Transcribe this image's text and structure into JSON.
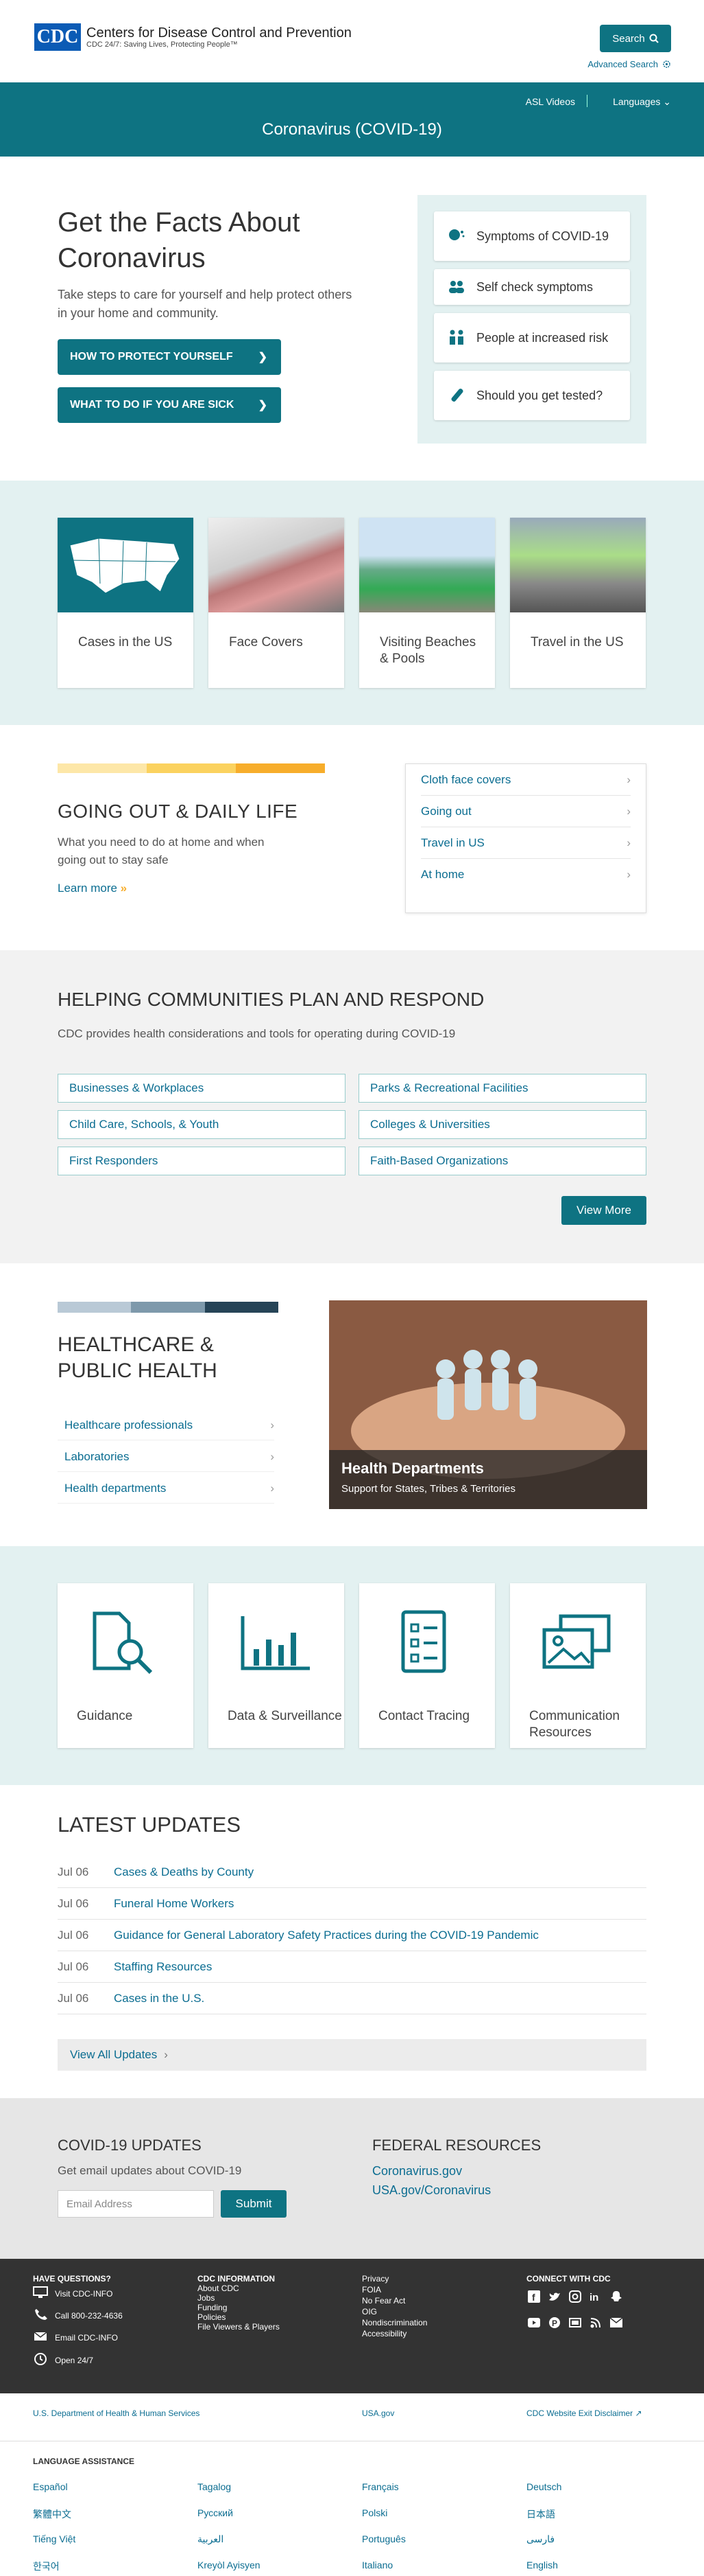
{
  "header": {
    "logo_text": "CDC",
    "org_name": "Centers for Disease Control and Prevention",
    "tagline": "CDC 24/7: Saving Lives, Protecting People™",
    "search_label": "Search",
    "advanced_search": "Advanced Search"
  },
  "banner": {
    "title": "Coronavirus (COVID-19)",
    "asl": "ASL Videos",
    "languages": "Languages"
  },
  "hero": {
    "title": "Get the Facts About Coronavirus",
    "lead": "Take steps to care for yourself and help protect others in your home and community.",
    "btn_protect": "HOW TO PROTECT YOURSELF",
    "btn_sick": "WHAT TO DO IF YOU ARE SICK",
    "links": [
      {
        "label": "Symptoms of COVID-19",
        "icon": "cough-icon"
      },
      {
        "label": "Self check symptoms",
        "icon": "people-icon"
      },
      {
        "label": "People at increased risk",
        "icon": "risk-icon"
      },
      {
        "label": "Should you get tested?",
        "icon": "test-icon"
      }
    ]
  },
  "tiles": [
    {
      "label": "Cases in the US"
    },
    {
      "label": "Face Covers"
    },
    {
      "label": "Visiting Beaches & Pools"
    },
    {
      "label": "Travel in the US"
    }
  ],
  "going_out": {
    "title": "GOING OUT & DAILY LIFE",
    "text": "What you need to do at home and when going out to stay safe",
    "more": "Learn more",
    "links": [
      "Cloth face covers",
      "Going out",
      "Travel in US",
      "At home"
    ],
    "bar_colors": [
      "#fde7a8",
      "#fbd25f",
      "#f7ad2b"
    ]
  },
  "communities": {
    "title": "HELPING COMMUNITIES PLAN AND RESPOND",
    "text": "CDC provides health considerations and tools for operating during COVID-19",
    "links": [
      "Businesses & Workplaces",
      "Parks & Recreational Facilities",
      "Child Care, Schools, & Youth",
      "Colleges & Universities",
      "First Responders",
      "Faith-Based Organizations"
    ],
    "view_more": "View More"
  },
  "healthcare": {
    "title": "HEALTHCARE & PUBLIC HEALTH",
    "links": [
      "Healthcare professionals",
      "Laboratories",
      "Health departments"
    ],
    "photo_title": "Health Departments",
    "photo_sub": "Support for States, Tribes & Territories",
    "bar_colors": [
      "#b9c9d6",
      "#7e99ab",
      "#264457"
    ]
  },
  "tools": [
    {
      "label": "Guidance"
    },
    {
      "label": "Data & Surveillance"
    },
    {
      "label": "Contact Tracing"
    },
    {
      "label": "Communication Resources"
    }
  ],
  "updates": {
    "title": "LATEST UPDATES",
    "rows": [
      {
        "date": "Jul 06",
        "label": "Cases & Deaths by County"
      },
      {
        "date": "Jul 06",
        "label": "Funeral Home Workers"
      },
      {
        "date": "Jul 06",
        "label": "Guidance for General Laboratory Safety Practices during the COVID-19 Pandemic"
      },
      {
        "date": "Jul 06",
        "label": "Staffing Resources"
      },
      {
        "date": "Jul 06",
        "label": "Cases in the U.S."
      }
    ],
    "view_all": "View All Updates"
  },
  "signup": {
    "title": "COVID-19 UPDATES",
    "text": "Get email updates about COVID-19",
    "placeholder": "Email Address",
    "submit": "Submit",
    "fed_title": "FEDERAL RESOURCES",
    "fed_links": [
      "Coronavirus.gov",
      "USA.gov/Coronavirus"
    ]
  },
  "footer": {
    "questions": "HAVE QUESTIONS?",
    "visit": "Visit CDC-INFO",
    "call": "Call 800-232-4636",
    "email": "Email CDC-INFO",
    "open": "Open 24/7",
    "info_title": "CDC INFORMATION",
    "info_links": [
      "About CDC",
      "Jobs",
      "Funding",
      "Policies",
      "File Viewers & Players"
    ],
    "policy_links": [
      "Privacy",
      "FOIA",
      "No Fear Act",
      "OIG",
      "Nondiscrimination",
      "Accessibility"
    ],
    "connect": "CONNECT WITH CDC"
  },
  "bottom": {
    "hhs": "U.S. Department of Health & Human Services",
    "usa": "USA.gov",
    "exit": "CDC Website Exit Disclaimer",
    "lang_title": "LANGUAGE ASSISTANCE",
    "languages": [
      "Español",
      "Tagalog",
      "Français",
      "Deutsch",
      "繁體中文",
      "Русский",
      "Polski",
      "日本語",
      "Tiếng Việt",
      "العربية",
      "Português",
      "فارسی",
      "한국어",
      "Kreyòl Ayisyen",
      "Italiano",
      "English"
    ]
  }
}
